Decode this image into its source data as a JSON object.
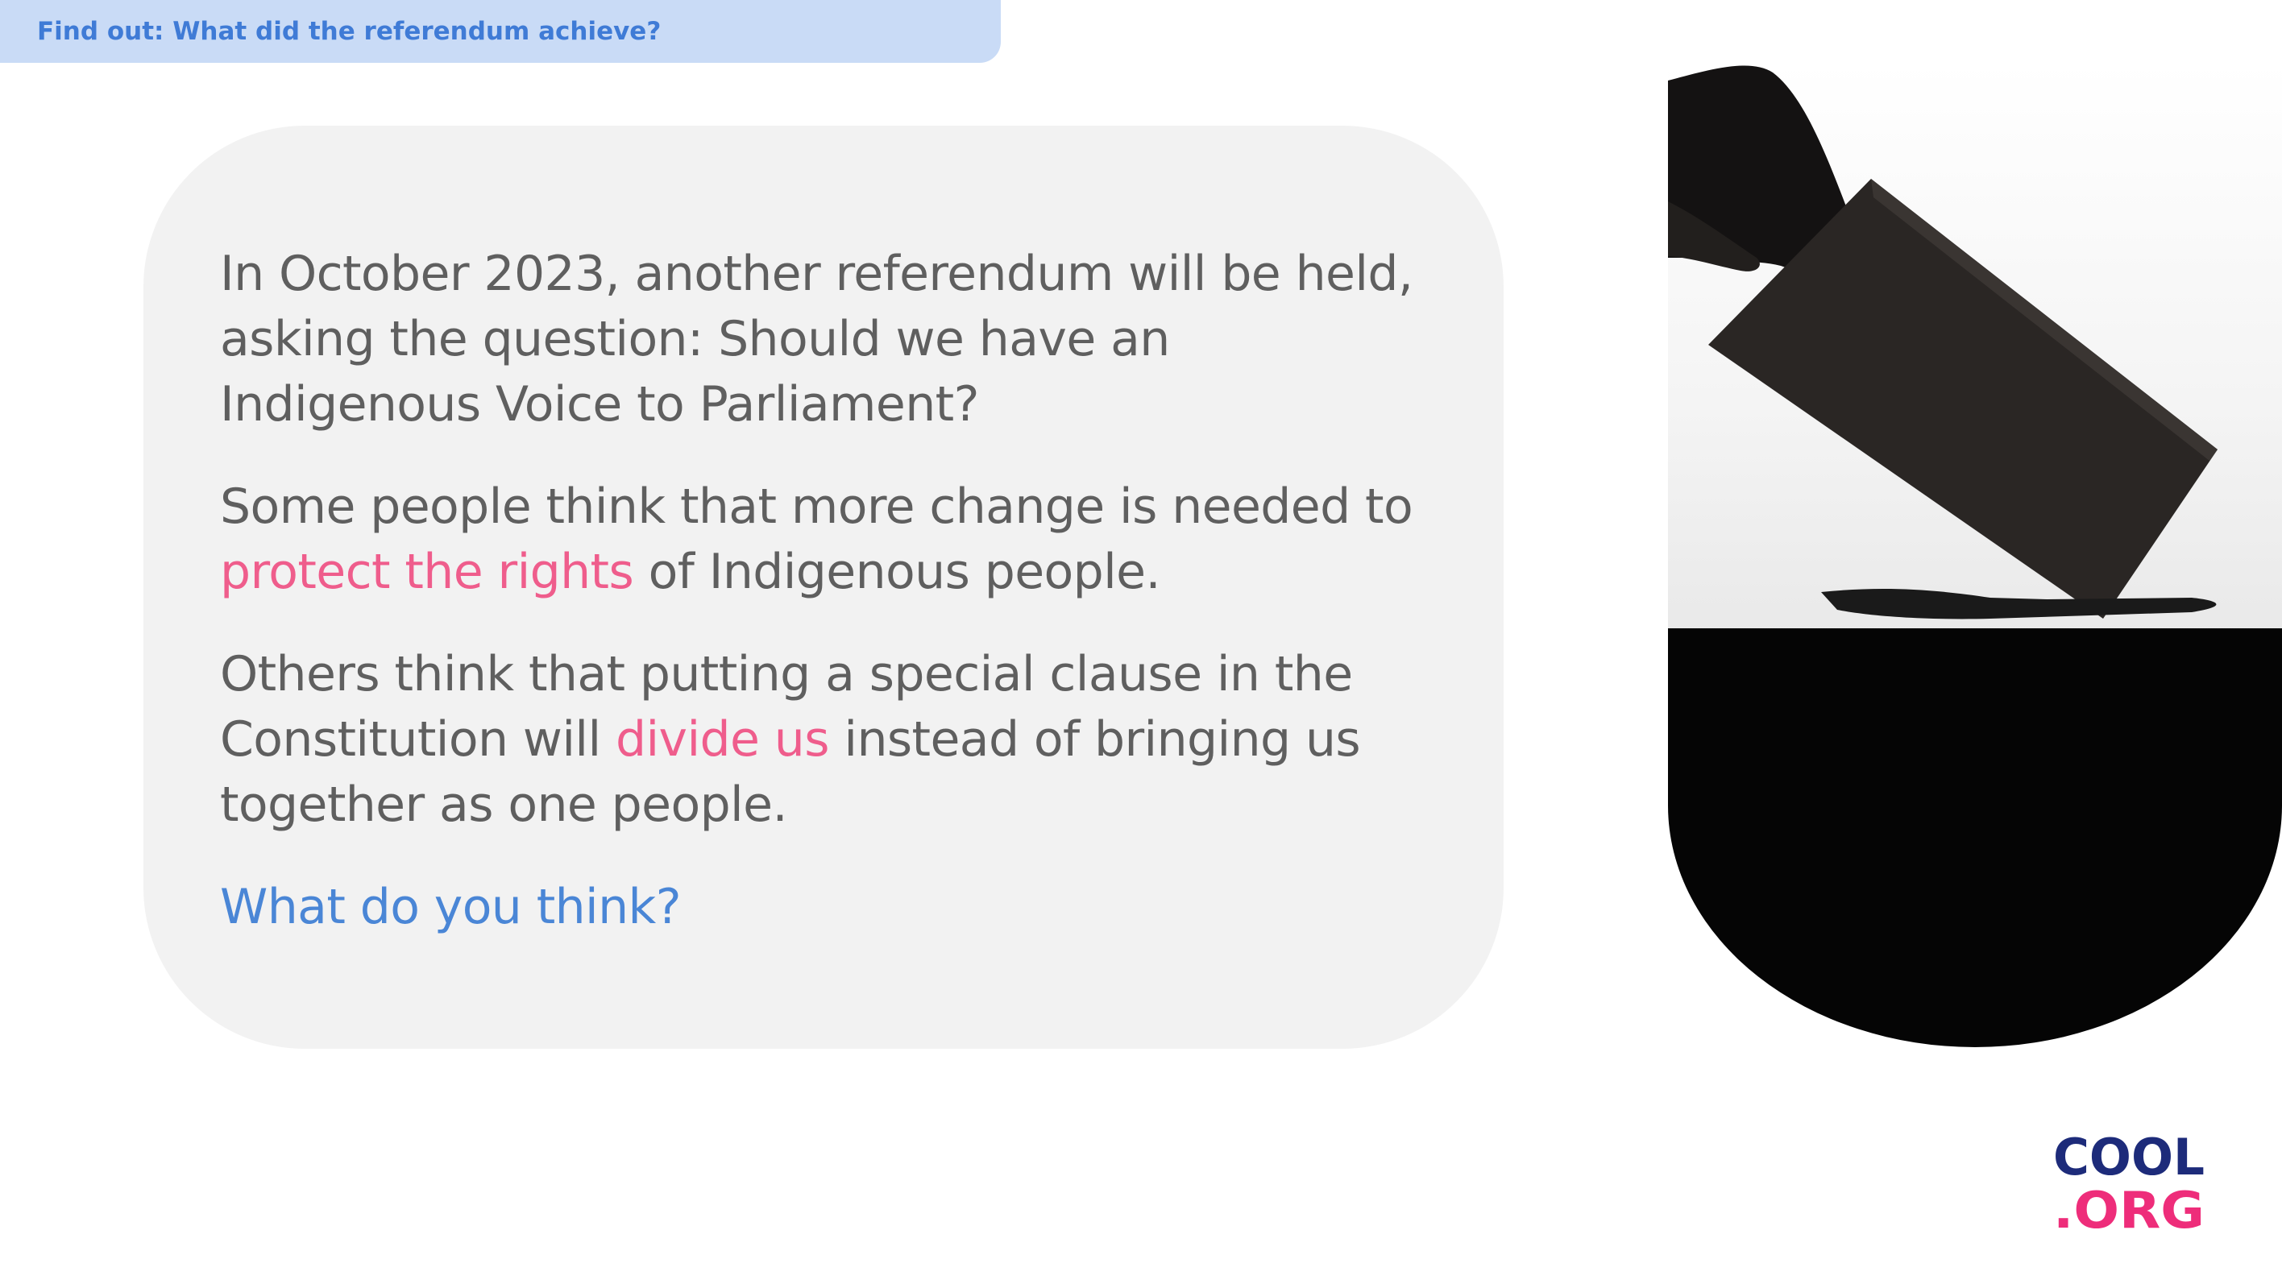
{
  "banner": {
    "text": "Find out: What did the referendum achieve?"
  },
  "content": {
    "p1": "In October 2023, another referendum will be held, asking the question: Should we have an Indigenous Voice to Parliament?",
    "p2_before": "Some people think that more change is needed to ",
    "p2_highlight": "protect the rights",
    "p2_after": " of Indigenous people.",
    "p3_before": "Others think that putting a special clause in the Constitution will ",
    "p3_highlight": "divide us",
    "p3_after": " instead of bringing us together as one people.",
    "question": "What do you think?"
  },
  "logo": {
    "line1": "COOL",
    "line2": ".ORG"
  },
  "colors": {
    "banner_bg": "#c9dbf6",
    "banner_text": "#3f7bd6",
    "body_text": "#5f5f5f",
    "highlight": "#ef5d8c",
    "question": "#4a86d6",
    "card_bg": "#f2f2f2",
    "logo_navy": "#1d2b7a",
    "logo_pink": "#ee2d7a"
  }
}
